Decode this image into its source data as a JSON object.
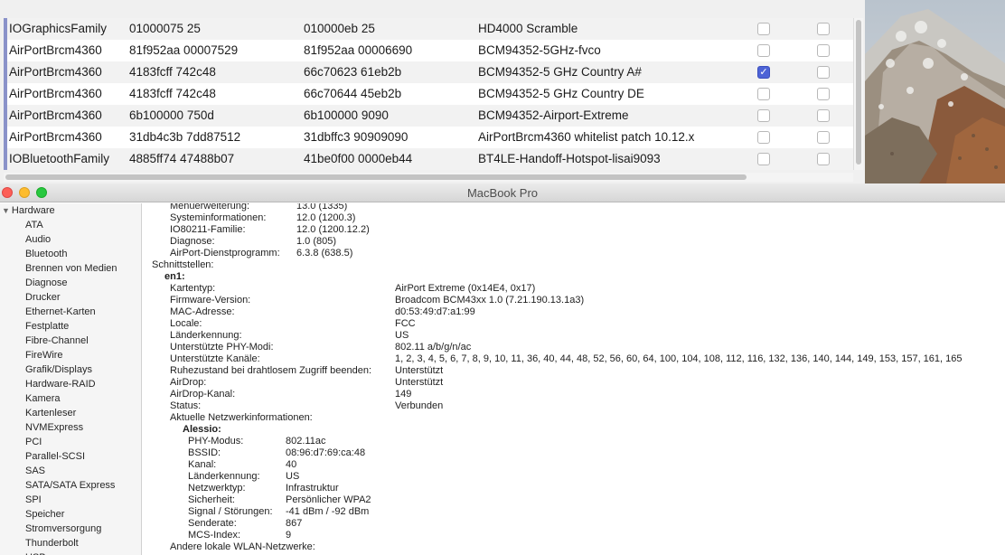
{
  "patch_table": {
    "rows": [
      {
        "name": "IOGraphicsFamily",
        "find": "01000075 25",
        "replace": "010000eb 25",
        "comment": "HD4000 Scramble",
        "col_a": false,
        "col_b": false
      },
      {
        "name": "AirPortBrcm4360",
        "find": "81f952aa 00007529",
        "replace": "81f952aa 00006690",
        "comment": "BCM94352-5GHz-fvco",
        "col_a": false,
        "col_b": false
      },
      {
        "name": "AirPortBrcm4360",
        "find": "4183fcff 742c48",
        "replace": "66c70623 61eb2b",
        "comment": "BCM94352-5 GHz Country A#",
        "col_a": true,
        "col_b": false
      },
      {
        "name": "AirPortBrcm4360",
        "find": "4183fcff 742c48",
        "replace": "66c70644 45eb2b",
        "comment": "BCM94352-5 GHz Country DE",
        "col_a": false,
        "col_b": false
      },
      {
        "name": "AirPortBrcm4360",
        "find": "6b100000 750d",
        "replace": "6b100000 9090",
        "comment": "BCM94352-Airport-Extreme",
        "col_a": false,
        "col_b": false
      },
      {
        "name": "AirPortBrcm4360",
        "find": "31db4c3b 7dd87512",
        "replace": "31dbffc3 90909090",
        "comment": "AirPortBrcm4360 whitelist patch 10.12.x",
        "col_a": false,
        "col_b": false
      },
      {
        "name": "IOBluetoothFamily",
        "find": "4885ff74 47488b07",
        "replace": "41be0f00 0000eb44",
        "comment": "BT4LE-Handoff-Hotspot-lisai9093",
        "col_a": false,
        "col_b": false
      }
    ]
  },
  "window": {
    "title": "MacBook Pro"
  },
  "sidebar": {
    "section": "Hardware",
    "items": [
      "ATA",
      "Audio",
      "Bluetooth",
      "Brennen von Medien",
      "Diagnose",
      "Drucker",
      "Ethernet-Karten",
      "Festplatte",
      "Fibre-Channel",
      "FireWire",
      "Grafik/Displays",
      "Hardware-RAID",
      "Kamera",
      "Kartenleser",
      "NVMExpress",
      "PCI",
      "Parallel-SCSI",
      "SAS",
      "SATA/SATA Express",
      "SPI",
      "Speicher",
      "Stromversorgung",
      "Thunderbolt",
      "USB"
    ]
  },
  "software_versions": [
    {
      "label": "Menüerweiterung:",
      "value": "13.0 (1335)"
    },
    {
      "label": "Systeminformationen:",
      "value": "12.0 (1200.3)"
    },
    {
      "label": "IO80211-Familie:",
      "value": "12.0 (1200.12.2)"
    },
    {
      "label": "Diagnose:",
      "value": "1.0 (805)"
    },
    {
      "label": "AirPort-Dienstprogramm:",
      "value": "6.3.8 (638.5)"
    }
  ],
  "interfaces": {
    "heading": "Schnittstellen:",
    "name": "en1:",
    "fields": [
      {
        "label": "Kartentyp:",
        "value": "AirPort Extreme  (0x14E4, 0x17)"
      },
      {
        "label": "Firmware-Version:",
        "value": "Broadcom BCM43xx 1.0 (7.21.190.13.1a3)"
      },
      {
        "label": "MAC-Adresse:",
        "value": "d0:53:49:d7:a1:99"
      },
      {
        "label": "Locale:",
        "value": "FCC"
      },
      {
        "label": "Länderkennung:",
        "value": "US"
      },
      {
        "label": "Unterstützte PHY-Modi:",
        "value": "802.11 a/b/g/n/ac"
      },
      {
        "label": "Unterstützte Kanäle:",
        "value": "1, 2, 3, 4, 5, 6, 7, 8, 9, 10, 11, 36, 40, 44, 48, 52, 56, 60, 64, 100, 104, 108, 112, 116, 132, 136, 140, 144, 149, 153, 157, 161, 165"
      },
      {
        "label": "Ruhezustand bei drahtlosem Zugriff beenden:",
        "value": "Unterstützt"
      },
      {
        "label": "AirDrop:",
        "value": "Unterstützt"
      },
      {
        "label": "AirDrop-Kanal:",
        "value": "149"
      },
      {
        "label": "Status:",
        "value": "Verbunden"
      }
    ],
    "current_network_heading": "Aktuelle Netzwerkinformationen:",
    "network_name": "Alessio:",
    "network_fields": [
      {
        "label": "PHY-Modus:",
        "value": "802.11ac"
      },
      {
        "label": "BSSID:",
        "value": "08:96:d7:69:ca:48"
      },
      {
        "label": "Kanal:",
        "value": "40"
      },
      {
        "label": "Länderkennung:",
        "value": "US"
      },
      {
        "label": "Netzwerktyp:",
        "value": "Infrastruktur"
      },
      {
        "label": "Sicherheit:",
        "value": "Persönlicher WPA2"
      },
      {
        "label": "Signal / Störungen:",
        "value": "-41 dBm / -92 dBm"
      },
      {
        "label": "Senderate:",
        "value": "867"
      },
      {
        "label": "MCS-Index:",
        "value": "9"
      }
    ],
    "other_networks_heading": "Andere lokale WLAN-Netzwerke:"
  },
  "colors": {
    "selection_bar": "#8a92c9",
    "checkbox_checked": "#4d63d6",
    "close": "#fc5f57",
    "minimize": "#fdbc2e",
    "maximize": "#28c840"
  }
}
